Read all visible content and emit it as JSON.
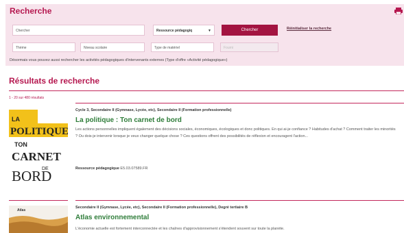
{
  "search": {
    "title": "Recherche",
    "keyword_value": "Chercher",
    "resource_select": "Ressource pédagogiq",
    "search_button": "Chercher",
    "reset_link": "Réinitialiser la recherche",
    "theme_placeholder": "Thème",
    "level_placeholder": "Niveau scolaire",
    "type_placeholder": "Type de matériel",
    "extra_placeholder": "Fourni",
    "note": "Désormais vous pouvez aussi rechercher les activités pédagogiques d'intervenants externes (Type d'offre «Activité pédagogique»)"
  },
  "results": {
    "title": "Résultats de recherche",
    "count": "1 - 20 sur 480 résultats",
    "items": [
      {
        "meta": "Cycle 3, Secondaire II (Gymnase, Lycée, etc), Secondaire II (Formation professionnelle)",
        "title": "La politique : Ton carnet de bord",
        "description": "Les actions personnelles impliquent également des décisions sociales, économiques, écologiques et donc politiques. En qui ai-je confiance ? Habitudes d'achat ? Comment traiter les minorités ? Ou dois-je intervenir lorsque je veux changer quelque chose ? Ces questions offrent des possibilités de réflexion et encouragent l'action...",
        "type_label": "Ressource pédagogique",
        "type_code": "E5.03.07589.FR",
        "cover_lines": [
          "LA",
          "POLITIQUE",
          "TON",
          "CARNET",
          "DE",
          "BORD"
        ]
      },
      {
        "meta": "Secondaire II (Gymnase, Lycée, etc), Secondaire II (Formation professionnelle), Degré tertiaire B",
        "title": "Atlas environnemental",
        "description": "L'économie actuelle est fortement interconnectée et les chaînes d'approvisionnement s'étendent souvent sur toute la planète.",
        "cover_label": "Atlas"
      }
    ]
  },
  "colors": {
    "accent": "#b5174f",
    "panel_bg": "#f7e3ec",
    "button": "#a31441",
    "title_green": "#2f7d3a"
  }
}
